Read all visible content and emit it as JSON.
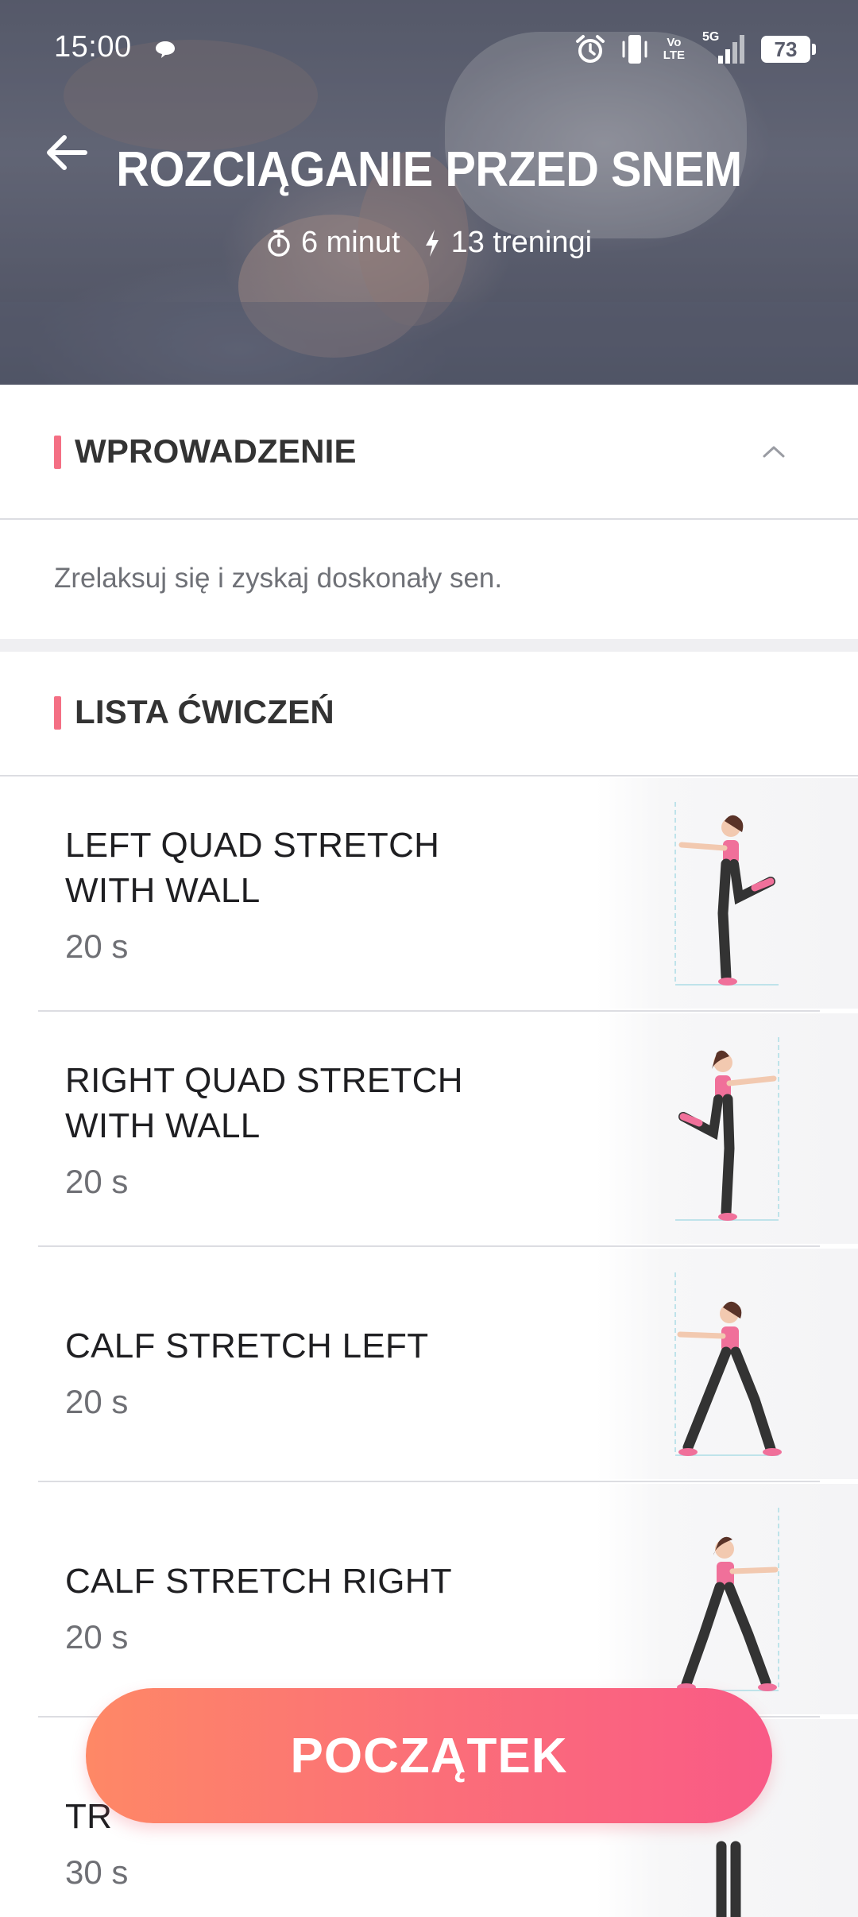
{
  "status_bar": {
    "time": "15:00",
    "battery": "73",
    "network": "5G",
    "volte_top": "Vo",
    "volte_bottom": "LTE",
    "icons": [
      "chat-bubble-icon",
      "alarm-icon",
      "vibrate-icon",
      "volte-icon",
      "signal-5g-icon",
      "battery-icon"
    ]
  },
  "header": {
    "back_icon": "arrow-left-icon",
    "title": "ROZCIĄGANIE PRZED SNEM",
    "duration": "6 minut",
    "workouts": "13 treningi",
    "duration_icon": "stopwatch-icon",
    "workouts_icon": "lightning-icon"
  },
  "intro": {
    "title": "WPROWADZENIE",
    "text": "Zrelaksuj się i zyskaj doskonały sen.",
    "expanded": true
  },
  "exercise_list": {
    "title": "LISTA ĆWICZEŃ",
    "items": [
      {
        "name": "LEFT QUAD STRETCH WITH WALL",
        "duration": "20 s"
      },
      {
        "name": "RIGHT QUAD STRETCH WITH WALL",
        "duration": "20 s"
      },
      {
        "name": "CALF STRETCH LEFT",
        "duration": "20 s"
      },
      {
        "name": "CALF STRETCH RIGHT",
        "duration": "20 s"
      },
      {
        "name": "TR",
        "duration": "30 s"
      }
    ]
  },
  "start_button": {
    "label": "POCZĄTEK"
  },
  "colors": {
    "accent": "#f46f84",
    "button_start": "#fe8866",
    "button_end": "#f95a86"
  }
}
